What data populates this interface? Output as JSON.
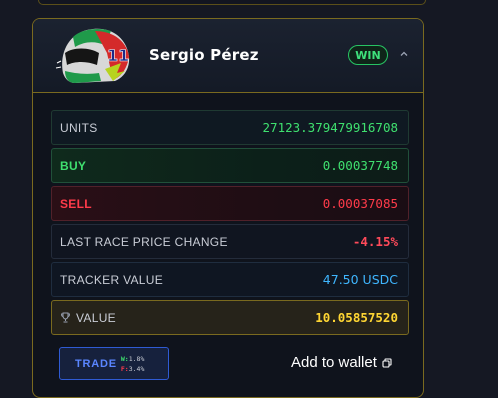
{
  "driver": {
    "name": "Sergio Pérez",
    "badge": "WIN",
    "helmet_number": "11"
  },
  "rows": {
    "units": {
      "label": "UNITS",
      "value": "27123.379479916708"
    },
    "buy": {
      "label": "BUY",
      "value": "0.00037748"
    },
    "sell": {
      "label": "SELL",
      "value": "0.00037085"
    },
    "last_race": {
      "label": "LAST RACE PRICE CHANGE",
      "value": "-4.15%"
    },
    "tracker": {
      "label": "TRACKER VALUE",
      "value": "47.50 USDC"
    },
    "value": {
      "label": "VALUE",
      "value": "10.05857520"
    }
  },
  "trade": {
    "label": "TRADE",
    "w_key": "W:",
    "w_value": "1.8%",
    "f_key": "F:",
    "f_value": "3.4%"
  },
  "wallet": {
    "label": "Add to wallet"
  },
  "icons": [
    "helmet-icon",
    "chevron-up-icon",
    "trophy-icon",
    "copy-icon"
  ],
  "colors": {
    "accent_gold": "#ffd633",
    "buy_green": "#3fe06f",
    "sell_red": "#ff3b4a",
    "tracker_blue": "#3fb6ff",
    "trade_blue": "#5a86ff"
  }
}
